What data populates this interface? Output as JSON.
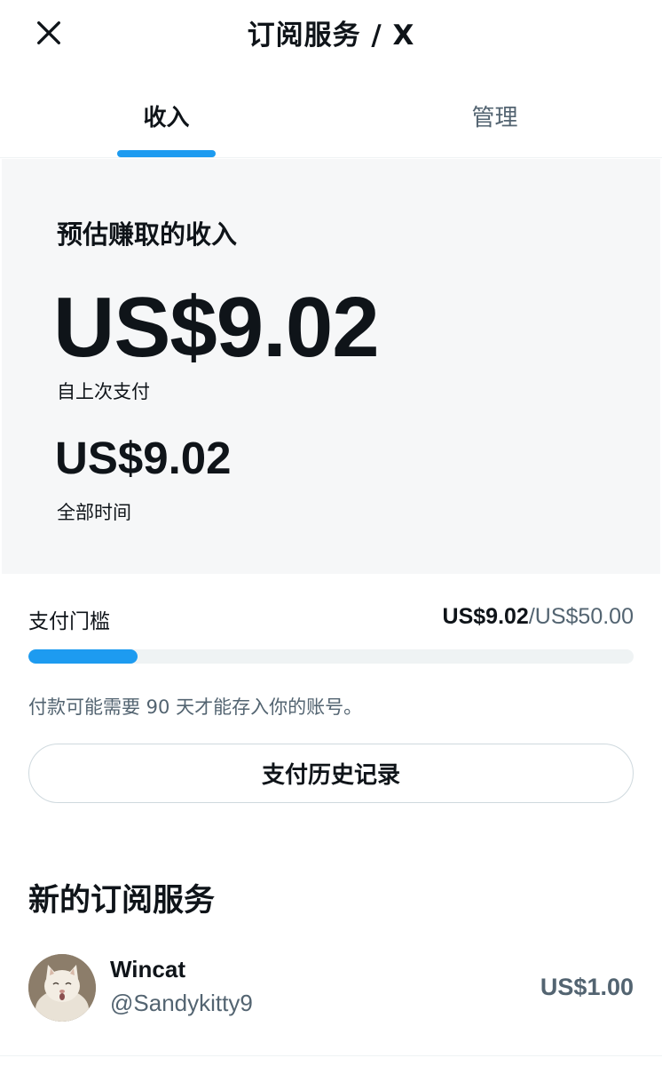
{
  "header": {
    "title": "订阅服务 / X",
    "close_icon": "close-icon"
  },
  "tabs": [
    {
      "label": "收入",
      "active": true
    },
    {
      "label": "管理",
      "active": false
    }
  ],
  "earnings": {
    "card_title": "预估赚取的收入",
    "since_last_payout_amount": "US$9.02",
    "since_last_payout_label": "自上次支付",
    "all_time_amount": "US$9.02",
    "all_time_label": "全部时间"
  },
  "payout_threshold": {
    "label": "支付门槛",
    "current": "US$9.02",
    "separator": "/",
    "target": "US$50.00",
    "progress_fraction": 0.18
  },
  "payout_note": "付款可能需要 90 天才能存入你的账号。",
  "history_button_label": "支付历史记录",
  "new_subscriptions": {
    "title": "新的订阅服务",
    "items": [
      {
        "name": "Wincat",
        "handle": "@Sandykitty9",
        "amount": "US$1.00",
        "avatar": "cat-avatar"
      }
    ]
  },
  "colors": {
    "accent": "#1d9bf0",
    "text_primary": "#0f1419",
    "text_secondary": "#536471",
    "card_bg": "#f6f7f8"
  }
}
